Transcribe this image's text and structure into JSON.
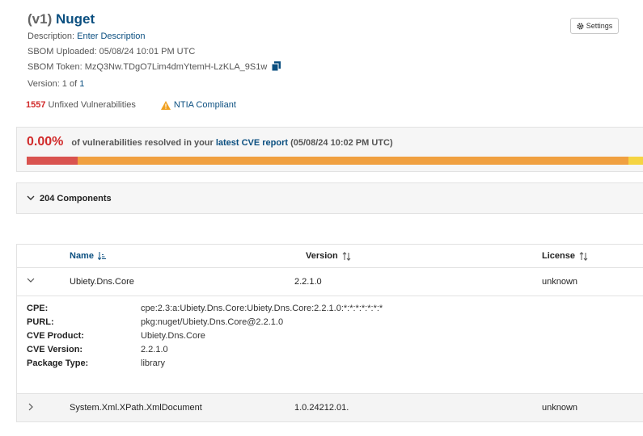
{
  "header": {
    "version_prefix": "(v1)",
    "name": "Nuget",
    "description_label": "Description:",
    "description_link": "Enter Description",
    "uploaded": "SBOM Uploaded: 05/08/24 10:01 PM UTC",
    "token": "SBOM Token: MzQ3Nw.TDgO7Lim4dmYtemH-LzKLA_9S1w",
    "version_label": "Version: 1 of",
    "version_link": "1"
  },
  "vulnerabilities": {
    "count": "1557",
    "label": "Unfixed Vulnerabilities",
    "ntia": "NTIA Compliant"
  },
  "settings_label": "Settings",
  "cve_report": {
    "percent": "0.00%",
    "text_before": "of vulnerabilities resolved in your",
    "link": "latest CVE report",
    "date": "(05/08/24 10:02 PM UTC)",
    "bar": [
      {
        "fraction": 0.082,
        "color": "#d9534f"
      },
      {
        "fraction": 0.893,
        "color": "#f0a040"
      },
      {
        "fraction": 0.025,
        "color": "#f5d442"
      }
    ]
  },
  "components": {
    "header": "204 Components",
    "columns": {
      "name": "Name",
      "version": "Version",
      "license": "License"
    },
    "rows": [
      {
        "name": "Ubiety.Dns.Core",
        "version": "2.2.1.0",
        "license": "unknown"
      },
      {
        "name": "System.Xml.XPath.XmlDocument",
        "version": "1.0.24212.01.",
        "license": "unknown"
      }
    ],
    "details": {
      "cpe_label": "CPE:",
      "cpe": "cpe:2.3:a:Ubiety.Dns.Core:Ubiety.Dns.Core:2.2.1.0:*:*:*:*:*:*:*",
      "purl_label": "PURL:",
      "purl": "pkg:nuget/Ubiety.Dns.Core@2.2.1.0",
      "cve_product_label": "CVE Product:",
      "cve_product": "Ubiety.Dns.Core",
      "cve_version_label": "CVE Version:",
      "cve_version": "2.2.1.0",
      "package_type_label": "Package Type:",
      "package_type": "library"
    }
  },
  "colors": {
    "accent": "#0b4f80",
    "danger": "#d12b2b",
    "warning": "#f0a020"
  }
}
